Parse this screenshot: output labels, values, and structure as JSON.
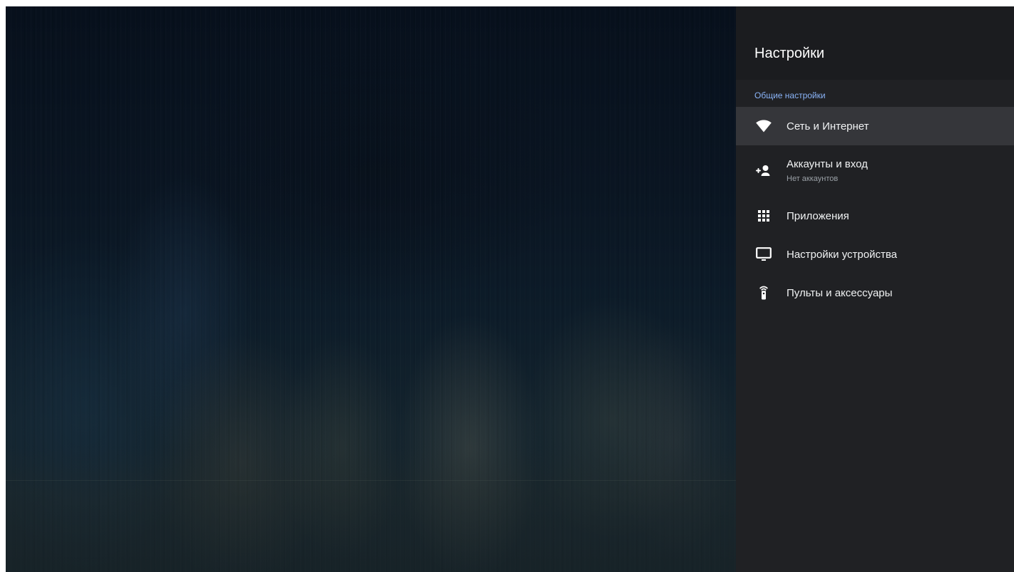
{
  "panel": {
    "title": "Настройки",
    "section_title": "Общие настройки"
  },
  "menu": {
    "items": [
      {
        "id": "network",
        "label": "Сеть и Интернет",
        "icon": "wifi-icon",
        "selected": true
      },
      {
        "id": "accounts",
        "label": "Аккаунты и вход",
        "subtitle": "Нет аккаунтов",
        "icon": "add-person-icon",
        "selected": false
      },
      {
        "id": "apps",
        "label": "Приложения",
        "icon": "apps-grid-icon",
        "selected": false
      },
      {
        "id": "device",
        "label": "Настройки устройства",
        "icon": "tv-icon",
        "selected": false
      },
      {
        "id": "remotes",
        "label": "Пульты и аксессуары",
        "icon": "remote-icon",
        "selected": false
      }
    ]
  },
  "colors": {
    "panel_background": "#202124",
    "header_background": "#1b1c1f",
    "selected_item_background": "#35363a",
    "section_title": "#8ab4f8",
    "primary_text": "#f1f3f4",
    "secondary_text": "#9aa0a6"
  }
}
